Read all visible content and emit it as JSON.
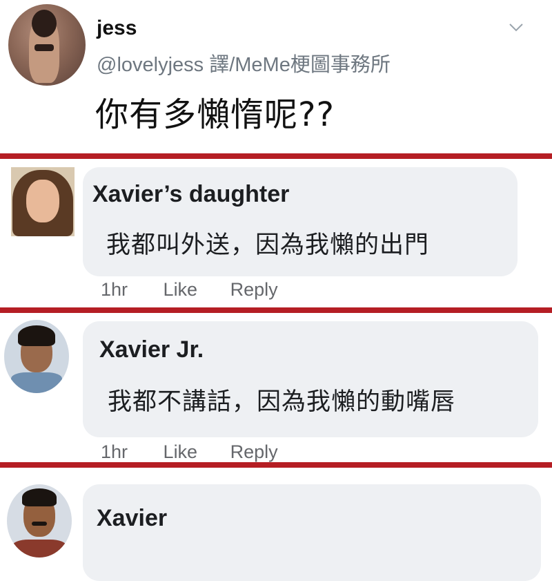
{
  "tweet": {
    "user_name": "jess",
    "user_handle": "@lovelyjess 譯/MeMe梗圖事務所",
    "text": "你有多懶惰呢??"
  },
  "comments": [
    {
      "author": "Xavier’s daughter",
      "text": "我都叫外送，因為我懶的出門",
      "time": "1hr",
      "like_label": "Like",
      "reply_label": "Reply"
    },
    {
      "author": "Xavier Jr.",
      "text": "我都不講話，因為我懶的動嘴唇",
      "time": "1hr",
      "like_label": "Like",
      "reply_label": "Reply"
    },
    {
      "author": "Xavier",
      "text": ""
    }
  ],
  "colors": {
    "divider": "#b51e24",
    "bubble": "#eef0f3",
    "meta_text": "#65676b"
  },
  "icons": {
    "tweet_menu": "chevron-down-icon"
  }
}
